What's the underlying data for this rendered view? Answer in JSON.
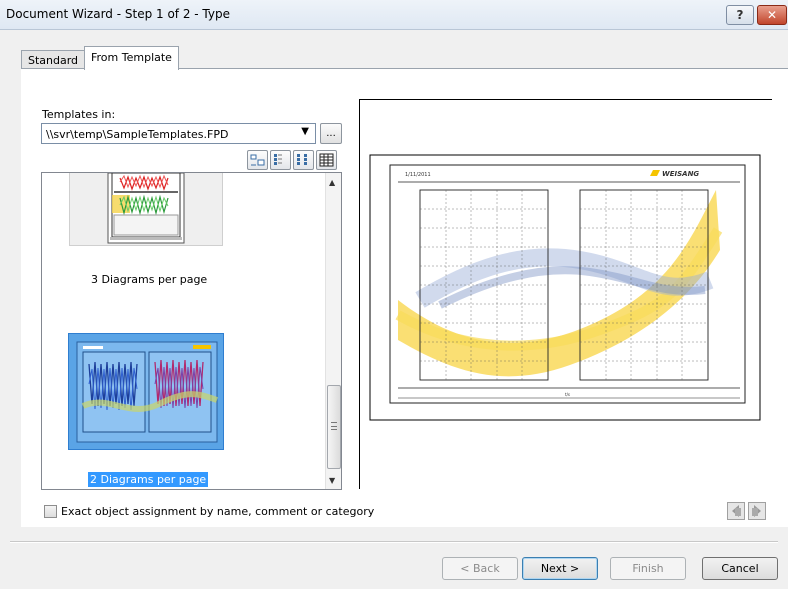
{
  "window": {
    "title": "Document Wizard - Step 1 of 2 - Type",
    "help_label": "?",
    "close_label": "✕"
  },
  "tabs": [
    {
      "label": "Standard",
      "active": false
    },
    {
      "label": "From Template",
      "active": true
    }
  ],
  "templates": {
    "label": "Templates in:",
    "path": "\\\\svr\\temp\\SampleTemplates.FPD",
    "browse_label": "...",
    "items": [
      {
        "caption": "3 Diagrams per page",
        "selected": false
      },
      {
        "caption": "2 Diagrams per page",
        "selected": true
      }
    ]
  },
  "preview": {
    "date": "1/11/2011",
    "brand": "WEISANG",
    "x_label": "t/s"
  },
  "options": {
    "exact_assignment_label": "Exact object assignment by name, comment or category",
    "exact_assignment_checked": false
  },
  "buttons": {
    "back": "< Back",
    "next": "Next >",
    "finish": "Finish",
    "cancel": "Cancel"
  },
  "colors": {
    "selection": "#3399ff",
    "brand_yellow": "#f5c400"
  }
}
